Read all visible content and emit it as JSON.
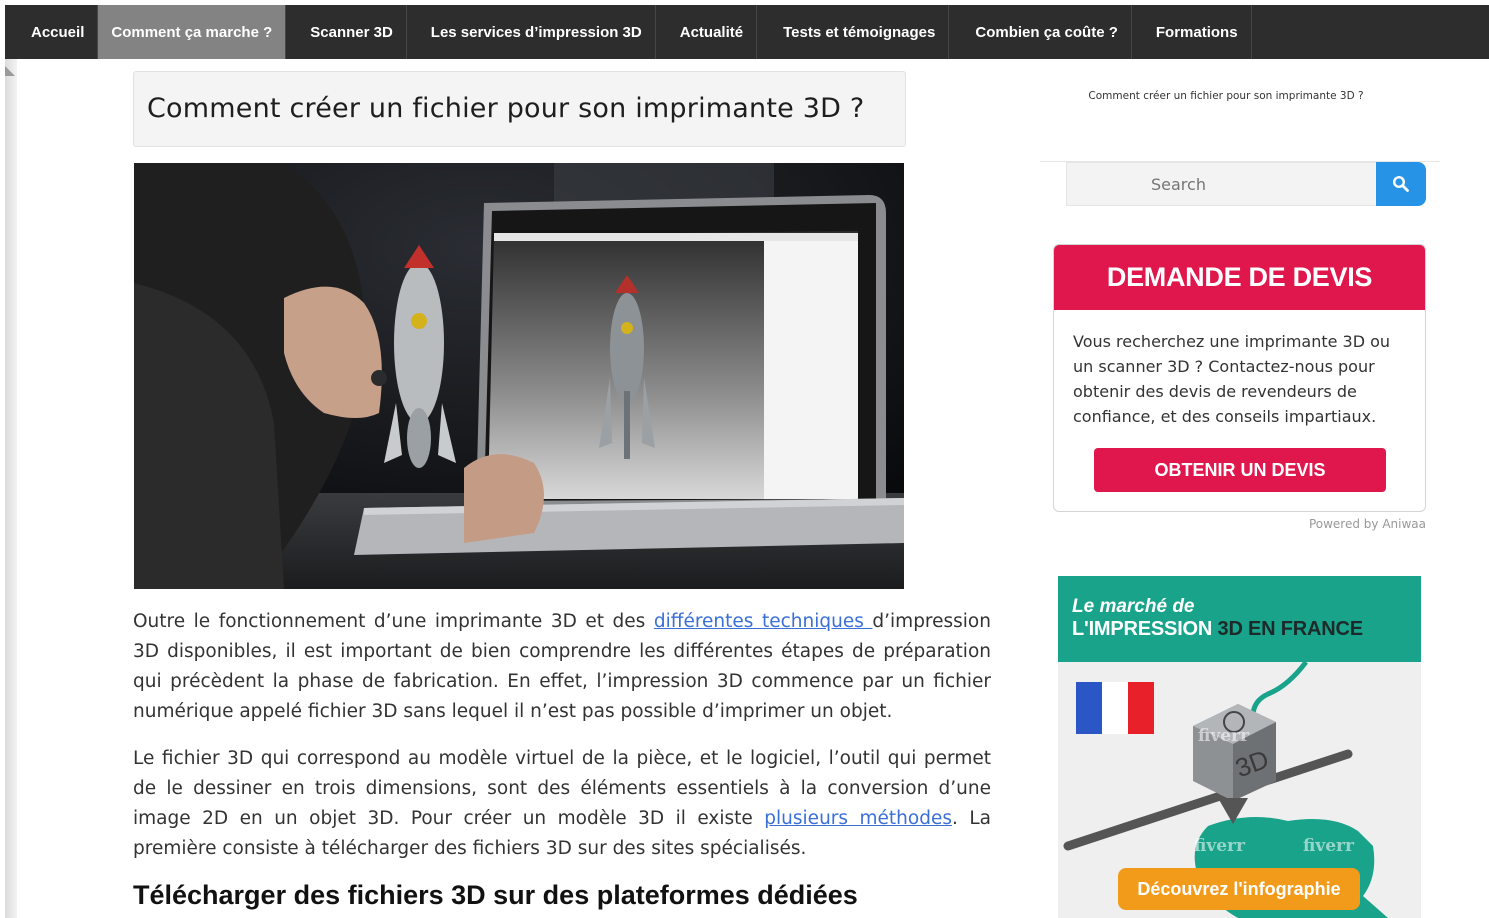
{
  "nav": {
    "items": [
      {
        "label": "Accueil",
        "active": false
      },
      {
        "label": "Comment ça marche ?",
        "active": true
      },
      {
        "label": "Scanner 3D",
        "active": false
      },
      {
        "label": "Les services d’impression 3D",
        "active": false
      },
      {
        "label": "Actualité",
        "active": false
      },
      {
        "label": "Tests et témoignages",
        "active": false
      },
      {
        "label": "Combien ça coûte ?",
        "active": false
      },
      {
        "label": "Formations",
        "active": false
      }
    ]
  },
  "article": {
    "title": "Comment créer un fichier pour son imprimante 3D ?",
    "hero_icon": "laptop-rocket-photo",
    "p1": {
      "before": "Outre le fonctionnement d’une imprimante 3D et des ",
      "link": "différentes techniques ",
      "after": "d’impression 3D disponibles, il est important de bien comprendre les différentes étapes de préparation qui précèdent la phase de fabrication. En effet, l’impression 3D commence par un fichier numérique appelé fichier 3D sans lequel il n’est pas possible d’imprimer un objet."
    },
    "p2": {
      "before": "Le fichier 3D qui correspond au modèle virtuel de la pièce, et le logiciel, l’outil qui permet de le dessiner en trois dimensions, sont des éléments essentiels à la conversion d’une image 2D en un objet 3D. Pour créer un modèle 3D il existe ",
      "link": "plusieurs méthodes",
      "after": ". La première consiste à télécharger des fichiers 3D sur des sites spécialisés."
    },
    "h2": "Télécharger des fichiers 3D sur des plateformes dédiées"
  },
  "sidebar": {
    "breadcrumb": "Comment créer un fichier pour son imprimante 3D ?",
    "search": {
      "placeholder": "Search",
      "icon": "search-icon"
    },
    "devis": {
      "title": "DEMANDE DE DEVIS",
      "text": "Vous recherchez une imprimante 3D ou un scanner 3D ? Contactez-nous pour obtenir des devis de revendeurs de confiance, et des conseils impartiaux.",
      "button": "OBTENIR UN DEVIS",
      "powered": "Powered by Aniwaa"
    },
    "ad": {
      "line1": "Le marché de",
      "line2a": "L'IMPRESSION ",
      "line2b": "3D",
      "line2c": " EN FRANCE",
      "printer_label": "3D",
      "watermark": "fiverr",
      "cta": "Découvrez l'infographie",
      "colors": {
        "header": "#1aa38b",
        "cta": "#f29b1b",
        "france": "#1aa38b"
      }
    }
  },
  "colors": {
    "nav": "#2d2d2d",
    "nav_active": "#838383",
    "accent": "#e0174d",
    "link": "#3a6fd8",
    "search": "#2793e6"
  }
}
